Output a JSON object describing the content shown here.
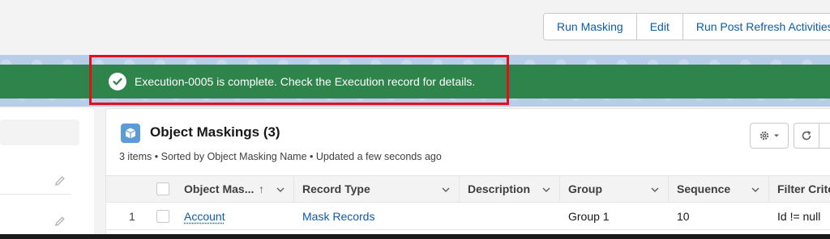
{
  "header": {
    "buttons": [
      "Run Masking",
      "Edit",
      "Run Post Refresh Activities"
    ]
  },
  "toast": {
    "message": "Execution-0005 is complete. Check the Execution record for details.",
    "icon": "check-circle-icon",
    "color": "#2e844a"
  },
  "card": {
    "title": "Object Maskings (3)",
    "subtitle": "3 items • Sorted by Object Masking Name • Updated a few seconds ago",
    "icon": "cube-icon"
  },
  "table": {
    "columns": [
      "Object Mas...",
      "Record Type",
      "Description",
      "Group",
      "Sequence",
      "Filter Crite"
    ],
    "sort_indicator": "↑",
    "rows": [
      {
        "number": "1",
        "object_masking": "Account",
        "record_type": "Mask Records",
        "description": "",
        "group": "Group 1",
        "sequence": "10",
        "filter_criteria": "Id != null"
      }
    ]
  },
  "colors": {
    "link": "#0b5cab",
    "highlight": "#e0111c"
  }
}
